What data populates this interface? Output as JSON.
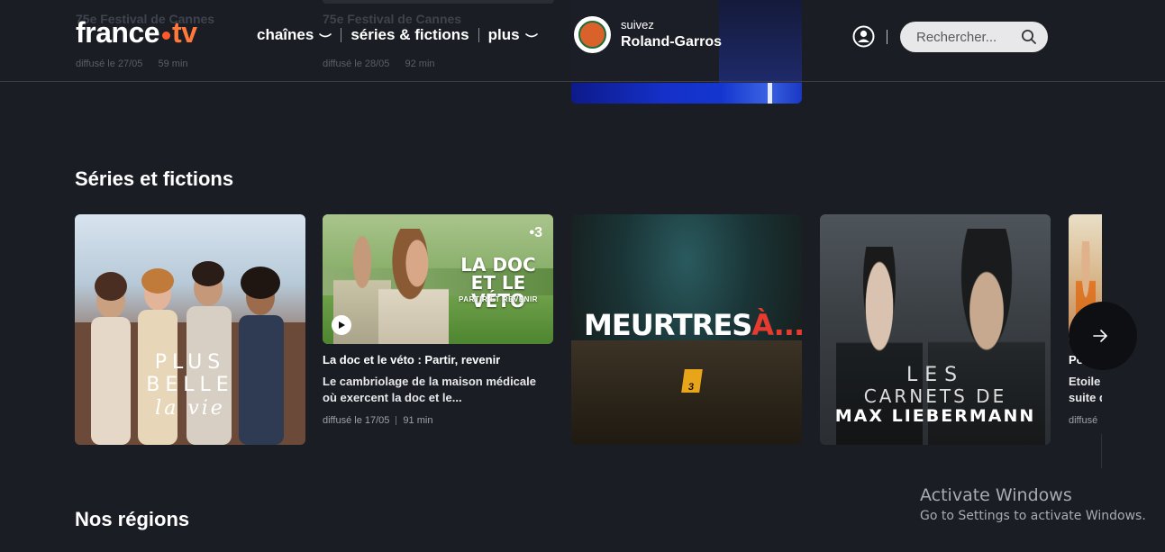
{
  "background_row": {
    "items": [
      {
        "title": "75e Festival de Cannes",
        "meta_date": "diffusé le 27/05",
        "meta_duration": "59 min"
      },
      {
        "title": "75e Festival de Cannes",
        "meta_date": "diffusé le 28/05",
        "meta_duration": "92 min"
      }
    ]
  },
  "header": {
    "logo_word": "france",
    "logo_tv": "tv",
    "nav": [
      {
        "label": "chaînes"
      },
      {
        "label": "séries & fictions"
      },
      {
        "label": "plus"
      }
    ],
    "promo_small": "suivez",
    "promo_big": "Roland-Garros",
    "search_placeholder": "Rechercher..."
  },
  "series_section": {
    "title": "Séries et fictions",
    "cards": [
      {
        "title_lines": [
          "PLUS",
          "BELLE",
          "la vie"
        ]
      },
      {
        "art_title_1": "LA DOC",
        "art_title_2": "ET LE VÉTO",
        "art_subtitle": "PARTIR ET REVENIR",
        "channel": "•3",
        "title": "La doc et le véto : Partir, revenir",
        "description": "Le cambriolage de la maison médicale où exercent la doc et le...",
        "date": "diffusé le 17/05",
        "duration": "91 min"
      },
      {
        "art_title_white": "MEURTRES",
        "art_title_red": "À...",
        "marker": "3"
      },
      {
        "art_line_1": "LES",
        "art_line_2": "CARNETS DE",
        "art_line_3": "MAX LIEBERMANN"
      },
      {
        "title": "Po",
        "description": "Etoile",
        "description_2": "suite d",
        "date": "diffusé"
      }
    ]
  },
  "regions_section": {
    "title": "Nos régions"
  },
  "watermark": {
    "line1": "Activate Windows",
    "line2": "Go to Settings to activate Windows."
  },
  "colors": {
    "background": "#1a1d24",
    "accent_orange": "#ff7a3a",
    "search_bg": "#e8e8ea"
  },
  "icons": [
    "user-icon",
    "search-icon",
    "chevron-down-icon",
    "play-icon",
    "arrow-right-icon"
  ]
}
